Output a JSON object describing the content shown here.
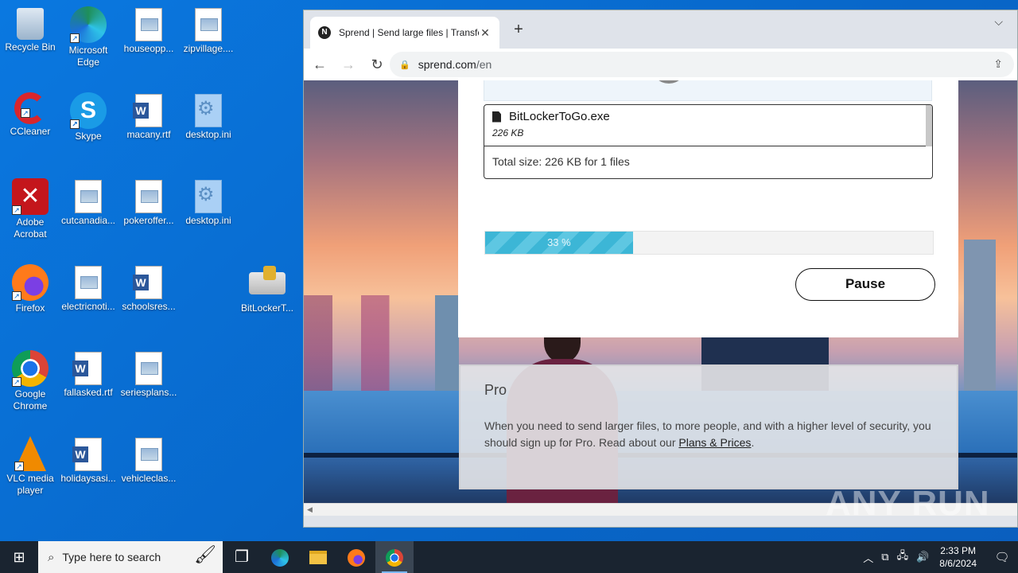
{
  "desktop_icons": [
    {
      "label": "Recycle Bin"
    },
    {
      "label": "Microsoft Edge"
    },
    {
      "label": "houseopp..."
    },
    {
      "label": "zipvillage...."
    },
    {
      "label": "CCleaner"
    },
    {
      "label": "Skype"
    },
    {
      "label": "macany.rtf"
    },
    {
      "label": "desktop.ini"
    },
    {
      "label": "Adobe Acrobat"
    },
    {
      "label": "cutcanadia..."
    },
    {
      "label": "pokeroffer..."
    },
    {
      "label": "desktop.ini"
    },
    {
      "label": "Firefox"
    },
    {
      "label": "electricnoti..."
    },
    {
      "label": "schoolsres..."
    },
    {
      "label": "BitLockerT..."
    },
    {
      "label": "Google Chrome"
    },
    {
      "label": "fallasked.rtf"
    },
    {
      "label": "seriesplans..."
    },
    {
      "label": "VLC media player"
    },
    {
      "label": "holidaysasi..."
    },
    {
      "label": "vehicleclas..."
    }
  ],
  "browser": {
    "tab_title": "Sprend | Send large files | Transfer",
    "tab_favicon": "N",
    "url_host": "sprend.com",
    "url_path": "/en"
  },
  "upload": {
    "file_name": "BitLockerToGo.exe",
    "file_size": "226 KB",
    "total": "Total size: 226 KB for 1 files",
    "progress_label": "33 %",
    "progress_fraction": 0.33,
    "pause_label": "Pause"
  },
  "pro": {
    "heading": "Pro",
    "text": "When you need to send larger files, to more people, and with a higher level of security, you should sign up for Pro. Read about our ",
    "link": "Plans & Prices",
    "end": "."
  },
  "watermark": "ANY RUN",
  "taskbar": {
    "search_placeholder": "Type here to search",
    "time": "2:33 PM",
    "date": "8/6/2024"
  }
}
